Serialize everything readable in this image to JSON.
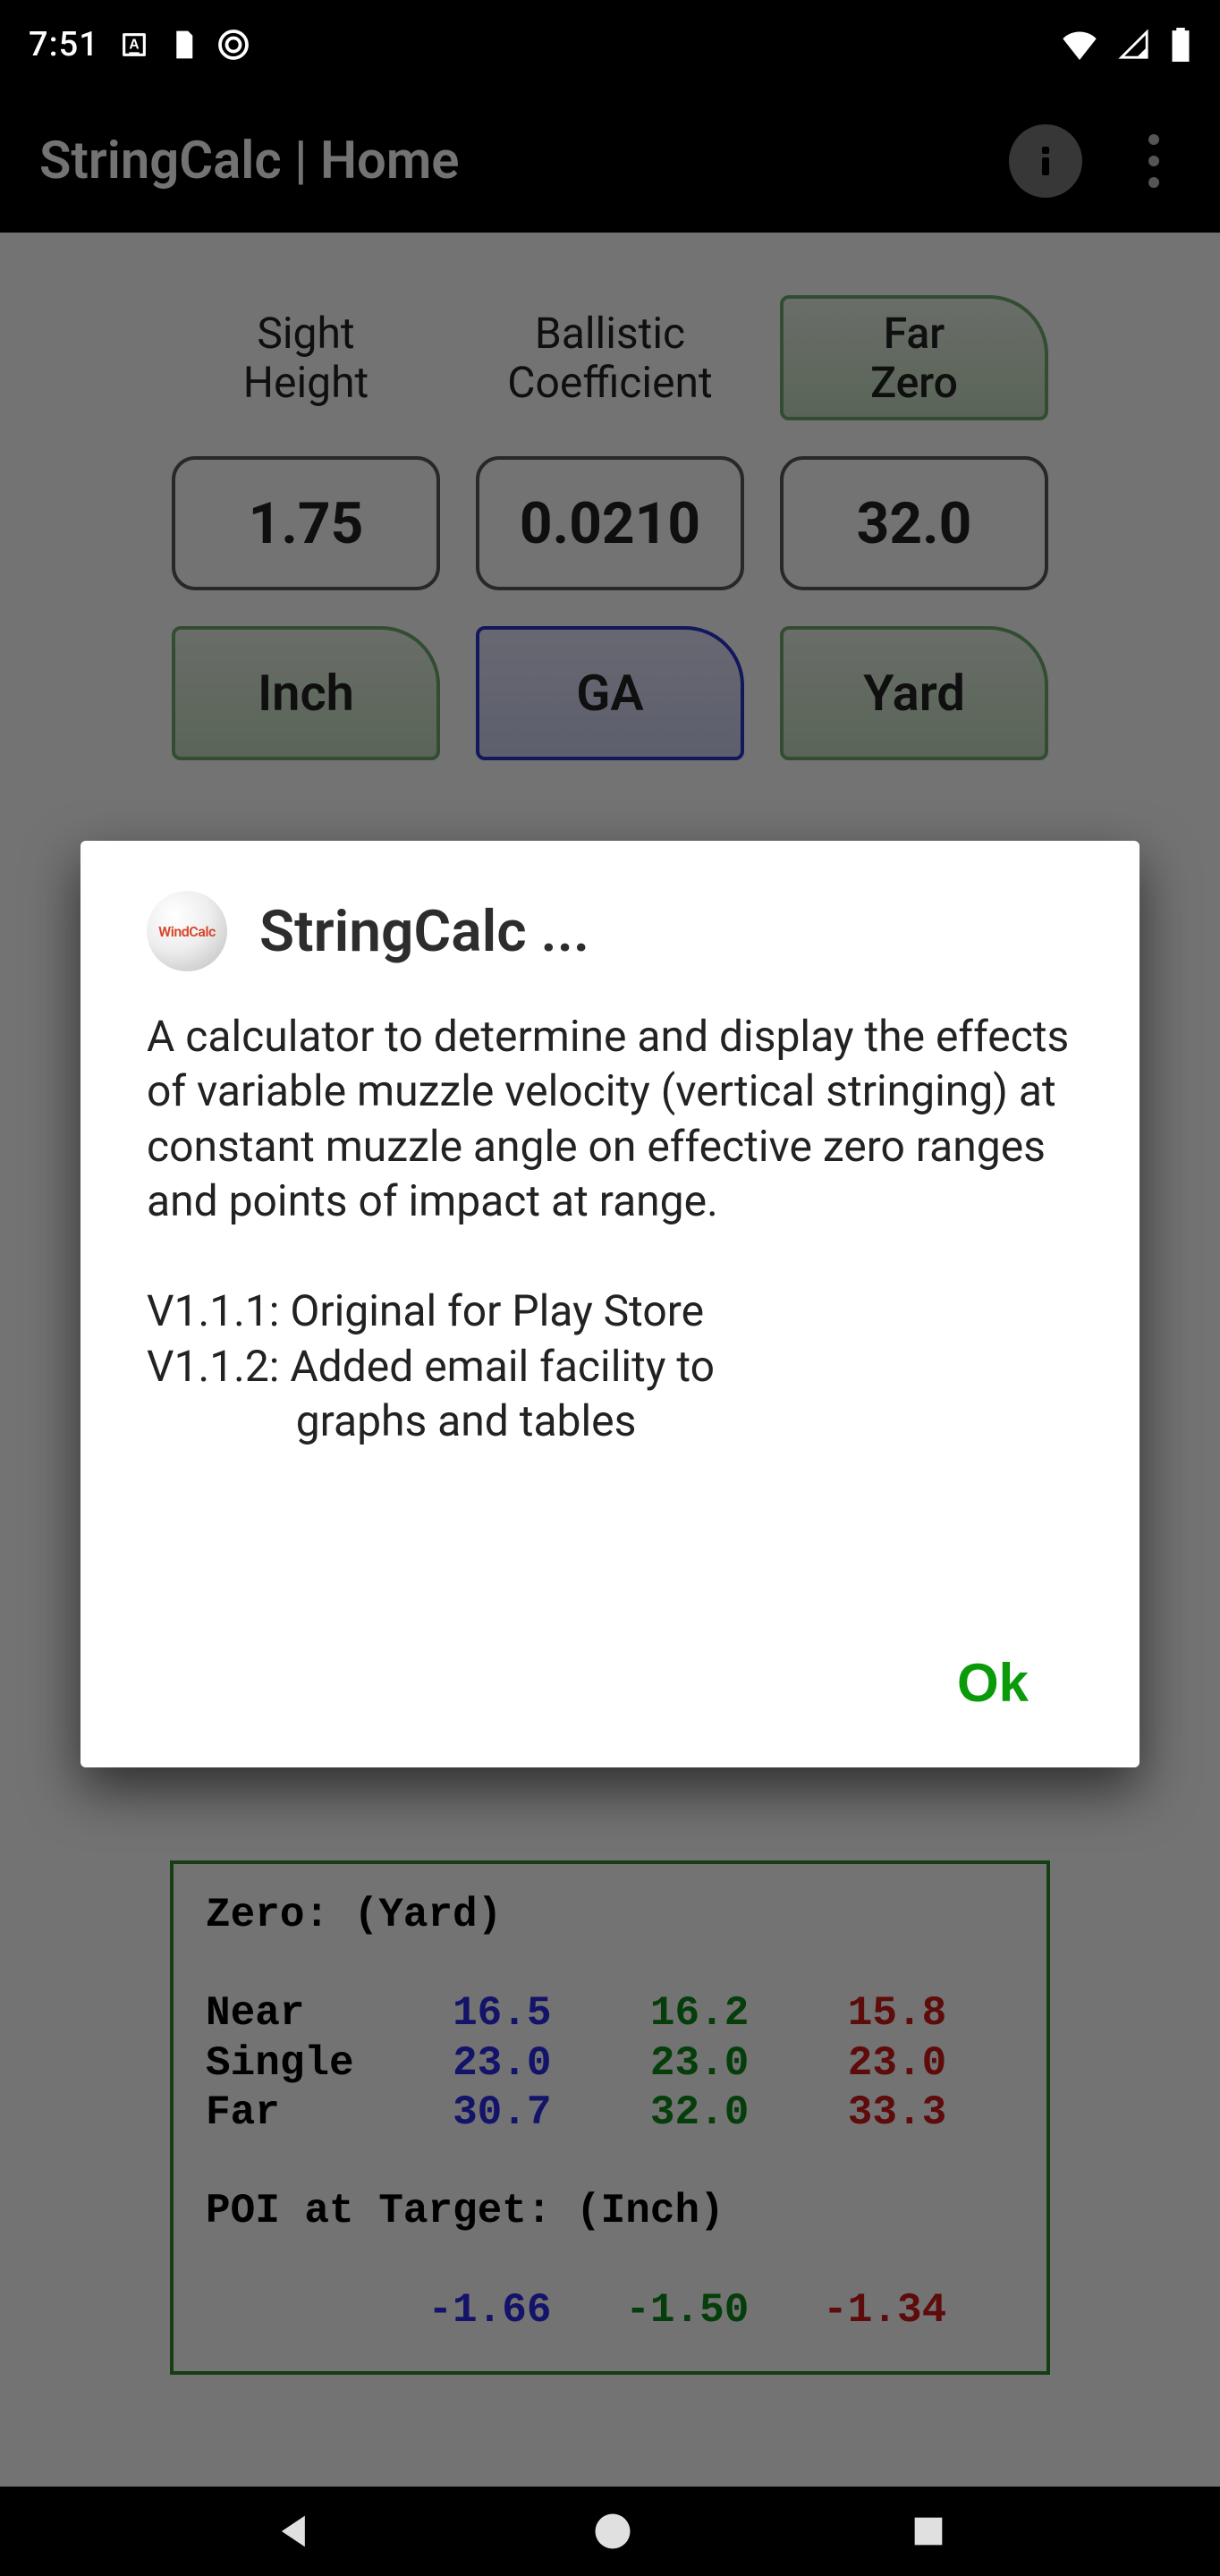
{
  "statusbar": {
    "time": "7:51"
  },
  "appbar": {
    "title": "StringCalc | Home"
  },
  "headers": {
    "sight_height_l1": "Sight",
    "sight_height_l2": "Height",
    "ballistic_l1": "Ballistic",
    "ballistic_l2": "Coefficient",
    "far_zero_l1": "Far",
    "far_zero_l2": "Zero"
  },
  "inputs": {
    "sight_height": "1.75",
    "ballistic_coef": "0.0210",
    "far_zero": "32.0"
  },
  "units": {
    "sight_height": "Inch",
    "ballistic_coef": "GA",
    "far_zero": "Yard"
  },
  "results": {
    "zero_header": "Zero: (Yard)",
    "rows": [
      {
        "label": "Near",
        "v1": "16.5",
        "v2": "16.2",
        "v3": "15.8"
      },
      {
        "label": "Single",
        "v1": "23.0",
        "v2": "23.0",
        "v3": "23.0"
      },
      {
        "label": "Far",
        "v1": "30.7",
        "v2": "32.0",
        "v3": "33.3"
      }
    ],
    "poi_header": "POI at Target: (Inch)",
    "poi": {
      "v1": "-1.66",
      "v2": "-1.50",
      "v3": "-1.34"
    }
  },
  "dialog": {
    "logo_text": "WindCalc",
    "title": "StringCalc ...",
    "body": "A calculator to determine and display the effects of variable muzzle velocity (vertical stringing) at constant muzzle angle on effective zero ranges and points of impact at range.\n\nV1.1.1: Original for Play Store\nV1.1.2: Added email facility to\n              graphs and tables",
    "ok": "Ok"
  }
}
